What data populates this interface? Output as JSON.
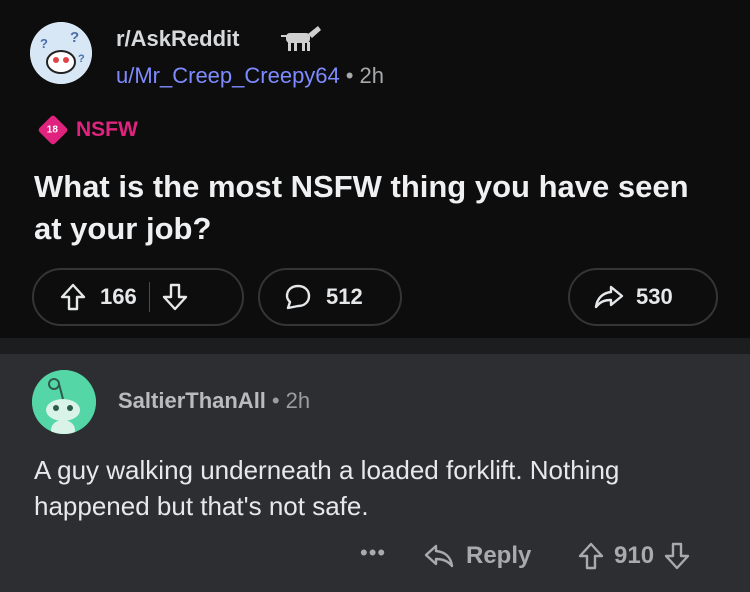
{
  "post": {
    "subreddit": "r/AskReddit",
    "author": "u/Mr_Creep_Creepy64",
    "separator": "•",
    "time": "2h",
    "nsfw_age": "18",
    "nsfw_label": "NSFW",
    "title": "What is the most NSFW thing you have seen at your job?",
    "upvotes": "166",
    "comments": "512",
    "shares": "530"
  },
  "comment": {
    "author": "SaltierThanAll",
    "separator": "•",
    "time": "2h",
    "body": "A guy walking underneath a loaded forklift. Nothing happened but that's not safe.",
    "more": "•••",
    "reply_label": "Reply",
    "votes": "910"
  },
  "colors": {
    "nsfw": "#e0237e",
    "username": "#7d8bff",
    "comment_avatar": "#55d6a7"
  },
  "icons": [
    "subreddit-avatar-icon",
    "donkey-flair-icon",
    "upvote-icon",
    "downvote-icon",
    "comment-icon",
    "share-icon",
    "reply-icon",
    "snoo-avatar-icon"
  ]
}
